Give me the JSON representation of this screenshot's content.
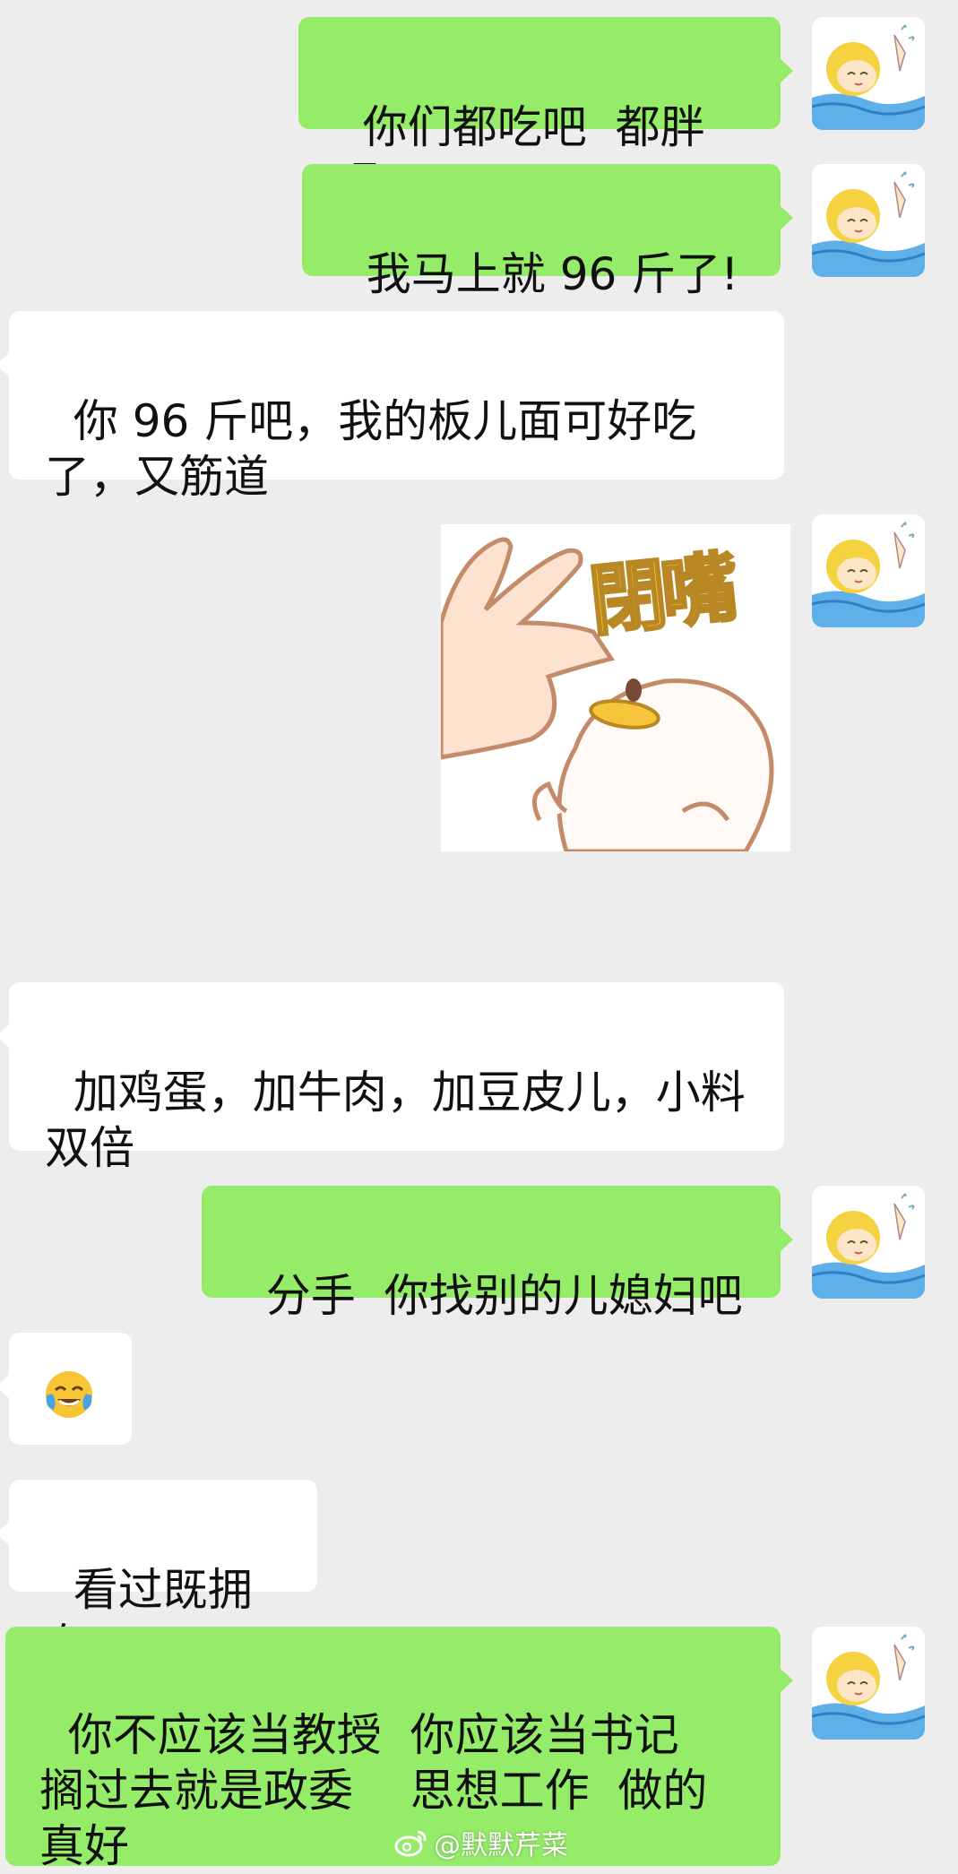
{
  "messages": [
    {
      "sender": "me",
      "text": "你们都吃吧  都胖吧"
    },
    {
      "sender": "me",
      "text": "我马上就 96 斤了!"
    },
    {
      "sender": "other",
      "text": "你 96 斤吧，我的板儿面可好吃了，又筋道"
    },
    {
      "sender": "me",
      "type": "sticker",
      "sticker_text": "閉嘴"
    },
    {
      "sender": "other",
      "text": "加鸡蛋，加牛肉，加豆皮儿，小料双倍"
    },
    {
      "sender": "me",
      "text": "分手  你找别的儿媳妇吧"
    },
    {
      "sender": "other",
      "type": "emoji",
      "emoji": "face-with-tears-of-joy-emoji"
    },
    {
      "sender": "other",
      "text": "看过既拥有"
    },
    {
      "sender": "me",
      "text": "你不应该当教授  你应该当书记  搁过去就是政委    思想工作  做的真好"
    }
  ],
  "watermark": {
    "text": "@默默芹菜",
    "icon": "weibo-icon"
  },
  "colors": {
    "background": "#ededed",
    "my_bubble": "#95ec69",
    "other_bubble": "#ffffff",
    "text": "#111111"
  }
}
